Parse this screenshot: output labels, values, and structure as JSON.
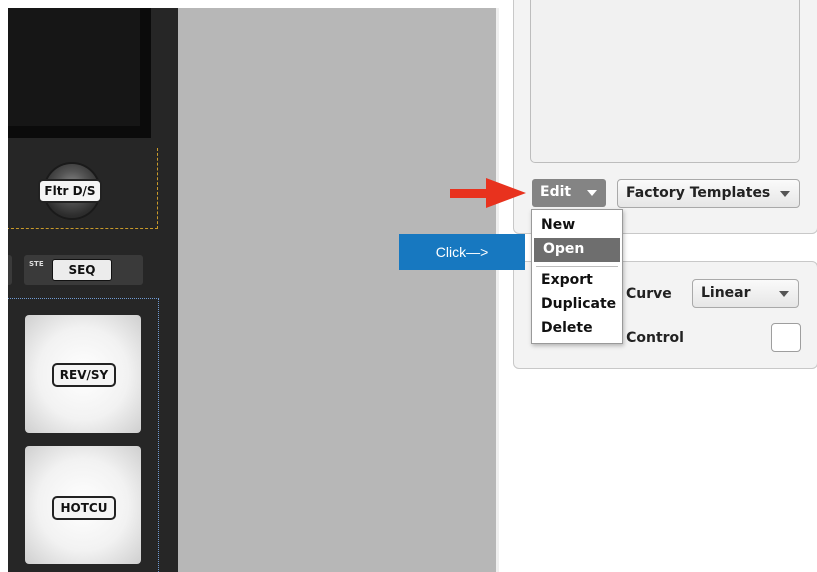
{
  "hardware": {
    "knob_label": "Fltr D/S",
    "step_label": "STE",
    "seq_label": "SEQ",
    "pad1_label": "REV/SY",
    "pad2_label": "HOTCU"
  },
  "settings": {
    "edit_button": "Edit",
    "template_select": "Factory Templates",
    "curve_label": "Curve",
    "curve_select": "Linear",
    "transport_label": "ort Control",
    "edit_menu": {
      "items": [
        "New",
        "Open",
        "Export",
        "Duplicate",
        "Delete"
      ],
      "highlighted": "Open"
    }
  },
  "annotation": {
    "callout_text": "Click—>",
    "arrow_color": "#e8321e",
    "callout_color": "#1778c0"
  },
  "icons": {
    "dropdown": "chevron-down-icon",
    "pointer": "red-arrow-icon"
  }
}
